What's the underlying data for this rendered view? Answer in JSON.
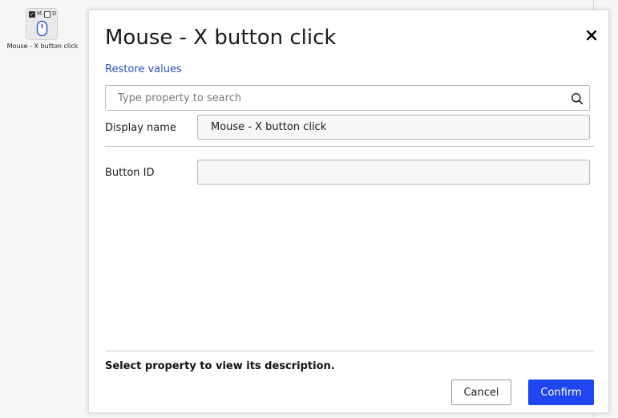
{
  "node": {
    "label": "Mouse - X button click",
    "checkbox_m_label": "M",
    "checkbox_d_label": "D",
    "icon": "mouse-icon"
  },
  "modal": {
    "title": "Mouse - X button click",
    "close_icon": "close-icon",
    "restore_label": "Restore values",
    "search": {
      "placeholder": "Type property to search",
      "value": "",
      "icon": "search-icon"
    },
    "properties": [
      {
        "label": "Display name",
        "value": "Mouse - X button click"
      },
      {
        "label": "Button ID",
        "value": ""
      }
    ],
    "description": "Select property to view its description.",
    "cancel_label": "Cancel",
    "confirm_label": "Confirm"
  },
  "colors": {
    "accent": "#1f46f0",
    "link": "#2a52be",
    "mouse_icon": "#3b63c9"
  }
}
